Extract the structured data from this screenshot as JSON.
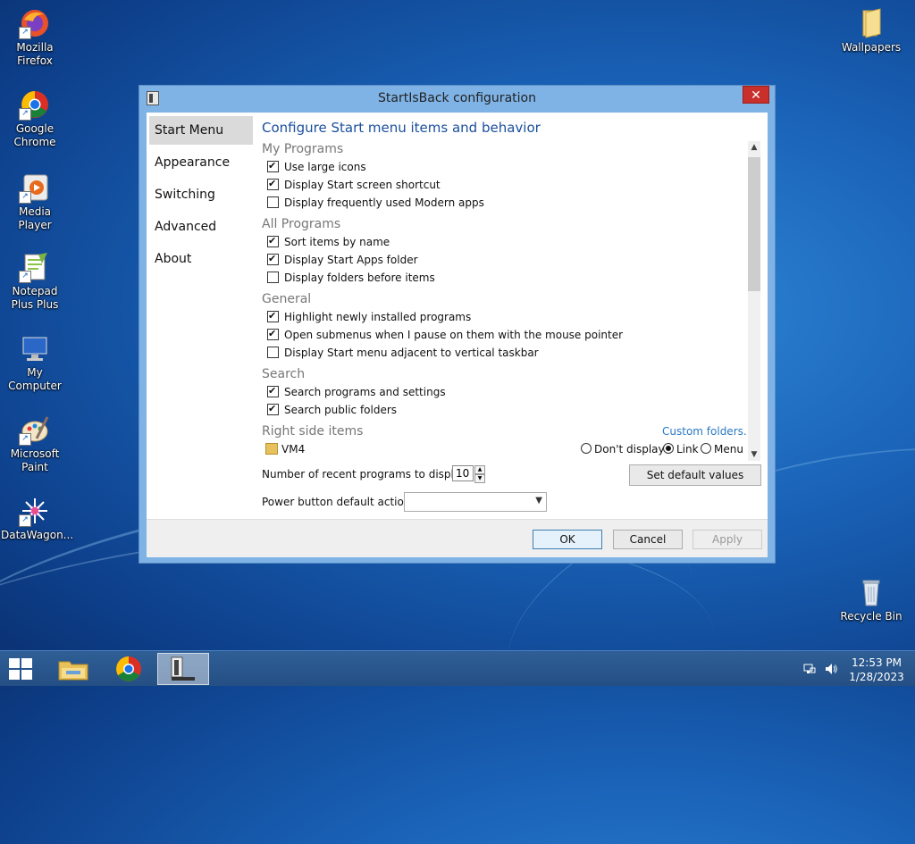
{
  "desktop": {
    "icons": [
      {
        "label": "Mozilla Firefox",
        "icon": "firefox-icon"
      },
      {
        "label": "Google Chrome",
        "icon": "chrome-icon"
      },
      {
        "label": "Media Player",
        "icon": "media-player-icon"
      },
      {
        "label": "Notepad Plus Plus",
        "icon": "notepad-plus-plus-icon"
      },
      {
        "label": "My Computer",
        "icon": "computer-icon"
      },
      {
        "label": "Microsoft Paint",
        "icon": "paint-icon"
      },
      {
        "label": "DataWagon...",
        "icon": "datawagon-icon"
      },
      {
        "label": "Wallpapers",
        "icon": "folder-icon"
      },
      {
        "label": "Recycle Bin",
        "icon": "recycle-bin-icon"
      }
    ]
  },
  "window": {
    "title": "StartIsBack configuration",
    "close_glyph": "✕",
    "nav": [
      "Start Menu",
      "Appearance",
      "Switching",
      "Advanced",
      "About"
    ],
    "active_nav": "Start Menu",
    "page_title": "Configure Start menu items and behavior",
    "sections": {
      "my_programs": {
        "heading": "My Programs",
        "options": [
          {
            "label": "Use large icons",
            "checked": true
          },
          {
            "label": "Display Start screen shortcut",
            "checked": true
          },
          {
            "label": "Display frequently used Modern apps",
            "checked": false
          }
        ]
      },
      "all_programs": {
        "heading": "All Programs",
        "options": [
          {
            "label": "Sort items by name",
            "checked": true
          },
          {
            "label": "Display Start Apps folder",
            "checked": true
          },
          {
            "label": "Display folders before items",
            "checked": false
          }
        ]
      },
      "general": {
        "heading": "General",
        "options": [
          {
            "label": "Highlight newly installed programs",
            "checked": true
          },
          {
            "label": "Open submenus when I pause on them with the mouse pointer",
            "checked": true
          },
          {
            "label": "Display Start menu adjacent to vertical taskbar",
            "checked": false
          }
        ]
      },
      "search": {
        "heading": "Search",
        "options": [
          {
            "label": "Search programs and settings",
            "checked": true
          },
          {
            "label": "Search public folders",
            "checked": true
          }
        ]
      },
      "right_side": {
        "heading": "Right side items",
        "custom_link": "Custom folders...",
        "item_label": "VM4",
        "radios": [
          "Don't display",
          "Link",
          "Menu"
        ],
        "selected_radio": "Link"
      }
    },
    "recent_label": "Number of recent programs to display:",
    "recent_value": "10",
    "set_default": "Set default values",
    "power_label": "Power button default action:",
    "power_value": "",
    "buttons": {
      "ok": "OK",
      "cancel": "Cancel",
      "apply": "Apply"
    }
  },
  "taskbar": {
    "time": "12:53 PM",
    "date": "1/28/2023",
    "pinned": [
      "file-explorer-icon",
      "chrome-icon",
      "startisback-icon"
    ]
  },
  "colors": {
    "accent": "#1a4f9c",
    "link": "#2a78c2",
    "close": "#c9302c"
  }
}
